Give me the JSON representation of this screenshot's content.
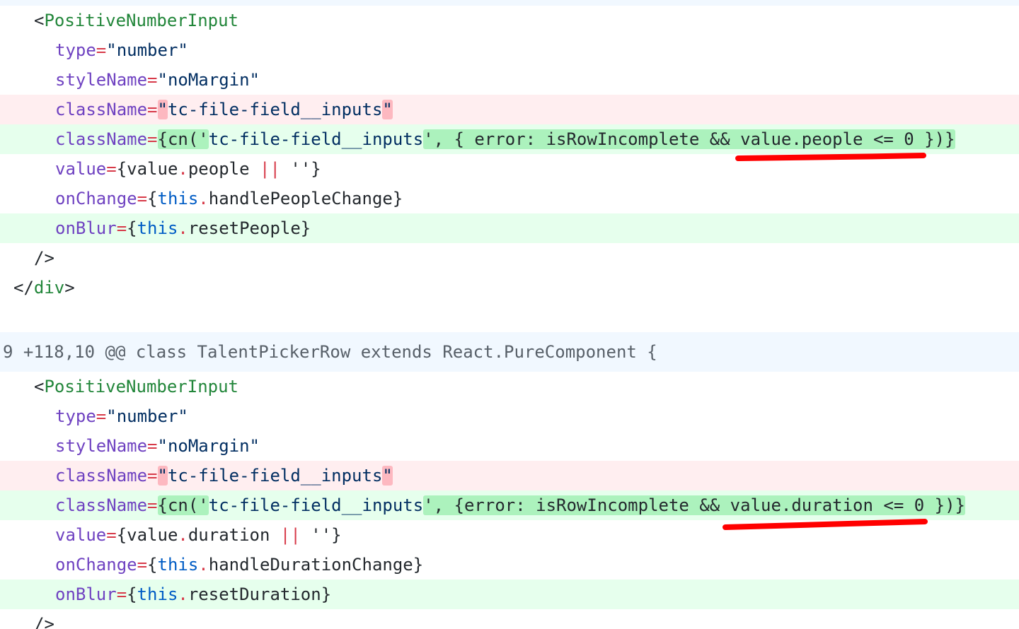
{
  "colors": {
    "deletion_background": "#ffeef0",
    "addition_background": "#e6ffed",
    "hunk_background": "#f1f8ff",
    "annotation_red": "#ff0000"
  },
  "block1": {
    "open_lt": "<",
    "component": "PositiveNumberInput",
    "type_attr": "type",
    "type_eq": "=",
    "type_val": "\"number\"",
    "style_attr": "styleName",
    "style_eq": "=",
    "style_val": "\"noMargin\"",
    "del_attr": "className",
    "del_eq": "=",
    "del_q1": "\"",
    "del_val": "tc-file-field__inputs",
    "del_q2": "\"",
    "add_attr": "className",
    "add_eq": "=",
    "add_hl1": "{cn('",
    "add_mid": "tc-file-field__inputs",
    "add_hl2": "', { error: isRowIncomplete && value.people <= 0 })}",
    "value_attr": "value",
    "value_eq": "=",
    "value_a": "{value",
    "value_dot": ".",
    "value_b": "people ",
    "value_or": "||",
    "value_c": " ''}",
    "onchange_attr": "onChange",
    "onchange_eq": "=",
    "onchange_brace": "{",
    "onchange_this": "this",
    "onchange_dot": ".",
    "onchange_rest": "handlePeopleChange}",
    "onblur_attr": "onBlur",
    "onblur_eq": "=",
    "onblur_brace": "{",
    "onblur_this": "this",
    "onblur_dot": ".",
    "onblur_rest": "resetPeople}",
    "self_close": "/>",
    "close_div_lt": "</",
    "close_div_tag": "div",
    "close_div_gt": ">"
  },
  "hunk_header": "9 +118,10 @@ class TalentPickerRow extends React.PureComponent {",
  "block2": {
    "open_lt": "<",
    "component": "PositiveNumberInput",
    "type_attr": "type",
    "type_eq": "=",
    "type_val": "\"number\"",
    "style_attr": "styleName",
    "style_eq": "=",
    "style_val": "\"noMargin\"",
    "del_attr": "className",
    "del_eq": "=",
    "del_q1": "\"",
    "del_val": "tc-file-field__inputs",
    "del_q2": "\"",
    "add_attr": "className",
    "add_eq": "=",
    "add_hl1": "{cn('",
    "add_mid": "tc-file-field__inputs",
    "add_hl2": "', {error: isRowIncomplete && value.duration <= 0 })}",
    "value_attr": "value",
    "value_eq": "=",
    "value_a": "{value",
    "value_dot": ".",
    "value_b": "duration ",
    "value_or": "||",
    "value_c": " ''}",
    "onchange_attr": "onChange",
    "onchange_eq": "=",
    "onchange_brace": "{",
    "onchange_this": "this",
    "onchange_dot": ".",
    "onchange_rest": "handleDurationChange}",
    "onblur_attr": "onBlur",
    "onblur_eq": "=",
    "onblur_brace": "{",
    "onblur_this": "this",
    "onblur_dot": ".",
    "onblur_rest": "resetDuration}",
    "self_close": "/>"
  }
}
